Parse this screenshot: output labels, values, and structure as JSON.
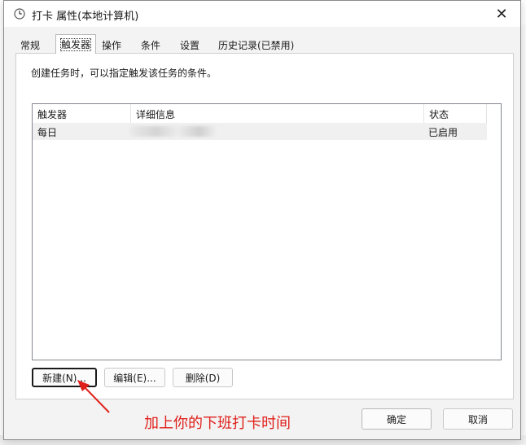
{
  "window": {
    "title": "打卡 属性(本地计算机)",
    "close_symbol": "✕"
  },
  "tabs": [
    {
      "label": "常规",
      "active": false
    },
    {
      "label": "触发器",
      "active": true
    },
    {
      "label": "操作",
      "active": false
    },
    {
      "label": "条件",
      "active": false
    },
    {
      "label": "设置",
      "active": false
    },
    {
      "label": "历史记录(已禁用)",
      "active": false
    }
  ],
  "trigger_panel": {
    "description": "创建任务时，可以指定触发该任务的条件。",
    "columns": [
      "触发器",
      "详细信息",
      "状态"
    ],
    "rows": [
      {
        "trigger": "每日",
        "details": "",
        "status": "已启用"
      }
    ]
  },
  "buttons": {
    "new": "新建(N)...",
    "edit": "编辑(E)...",
    "delete": "删除(D)",
    "ok": "确定",
    "cancel": "取消"
  },
  "annotation": {
    "text": "加上你的下班打卡时间",
    "color": "#e0201b"
  }
}
